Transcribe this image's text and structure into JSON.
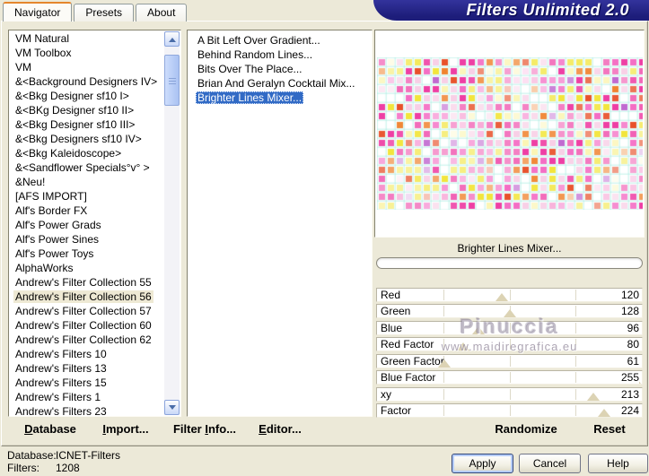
{
  "window": {
    "title_banner": "Filters Unlimited 2.0"
  },
  "tabs": [
    {
      "label": "Navigator",
      "active": true
    },
    {
      "label": "Presets",
      "active": false
    },
    {
      "label": "About",
      "active": false
    }
  ],
  "category_list": {
    "items": [
      "VM Natural",
      "VM Toolbox",
      "VM",
      "&<Background Designers IV>",
      "&<Bkg Designer sf10 I>",
      "&<BKg Designer sf10 II>",
      "&<Bkg Designer sf10 III>",
      "&<Bkg Designers sf10 IV>",
      "&<Bkg Kaleidoscope>",
      "&<Sandflower Specials°v° >",
      "&Neu!",
      "[AFS IMPORT]",
      "Alf's Border FX",
      "Alf's Power Grads",
      "Alf's Power Sines",
      "Alf's Power Toys",
      "AlphaWorks",
      "Andrew's Filter Collection 55",
      "Andrew's Filter Collection 56",
      "Andrew's Filter Collection 57",
      "Andrew's Filter Collection 60",
      "Andrew's Filter Collection 62",
      "Andrew's Filters 10",
      "Andrew's Filters 13",
      "Andrew's Filters 15",
      "Andrew's Filters 1",
      "Andrew's Filters 23"
    ],
    "highlighted_index": 18
  },
  "filter_list": {
    "items": [
      "A Bit Left Over Gradient...",
      "Behind Random Lines...",
      "Bits Over The Place...",
      "Brian And Geralyn Cocktail Mix...",
      "Brighter Lines Mixer..."
    ],
    "selected_index": 4
  },
  "preview": {
    "selected_filter_label": "Brighter Lines Mixer...",
    "palette": [
      {
        "hex": "#ee3fa4",
        "w": 22
      },
      {
        "hex": "#f46ec4",
        "w": 14
      },
      {
        "hex": "#f8cfe6",
        "w": 10
      },
      {
        "hex": "#f2e53c",
        "w": 16
      },
      {
        "hex": "#fbf5b4",
        "w": 6
      },
      {
        "hex": "#f08430",
        "w": 10
      },
      {
        "hex": "#e8512a",
        "w": 6
      },
      {
        "hex": "#c06ad0",
        "w": 5
      },
      {
        "hex": "#ffffff",
        "w": 11
      }
    ],
    "gutter_color": "rgba(178,238,230,0.55)"
  },
  "sliders": {
    "max": 255,
    "items": [
      {
        "label": "Red",
        "value": 120
      },
      {
        "label": "Green",
        "value": 128
      },
      {
        "label": "Blue",
        "value": 96
      },
      {
        "label": "Red Factor",
        "value": 80
      },
      {
        "label": "Green Factor",
        "value": 61
      },
      {
        "label": "Blue Factor",
        "value": 255
      },
      {
        "label": "xy",
        "value": 213
      },
      {
        "label": "Factor",
        "value": 224
      }
    ],
    "randomize_label": "Randomize",
    "reset_label": "Reset"
  },
  "watermark": {
    "line1": "Pinuccia",
    "line2": "www.maidiregrafica.eu"
  },
  "toolbar": [
    {
      "name": "database",
      "pre": "",
      "mnemonic": "D",
      "post": "atabase"
    },
    {
      "name": "import",
      "pre": "",
      "mnemonic": "I",
      "post": "mport..."
    },
    {
      "name": "filter-info",
      "pre": "Filter ",
      "mnemonic": "I",
      "post": "nfo..."
    },
    {
      "name": "editor",
      "pre": "",
      "mnemonic": "E",
      "post": "ditor..."
    }
  ],
  "status": {
    "database_label": "Database:",
    "database_value": "ICNET-Filters",
    "filters_label": "Filters:",
    "filters_value": "1208"
  },
  "dialog_buttons": {
    "apply": "Apply",
    "cancel": "Cancel",
    "help": "Help"
  },
  "colors": {
    "selection": "#316ac5",
    "banner": "#1d1d7a",
    "tab_accent": "#e5862c",
    "background": "#ece9d8",
    "slider_thumb": "#dcd3b4"
  }
}
